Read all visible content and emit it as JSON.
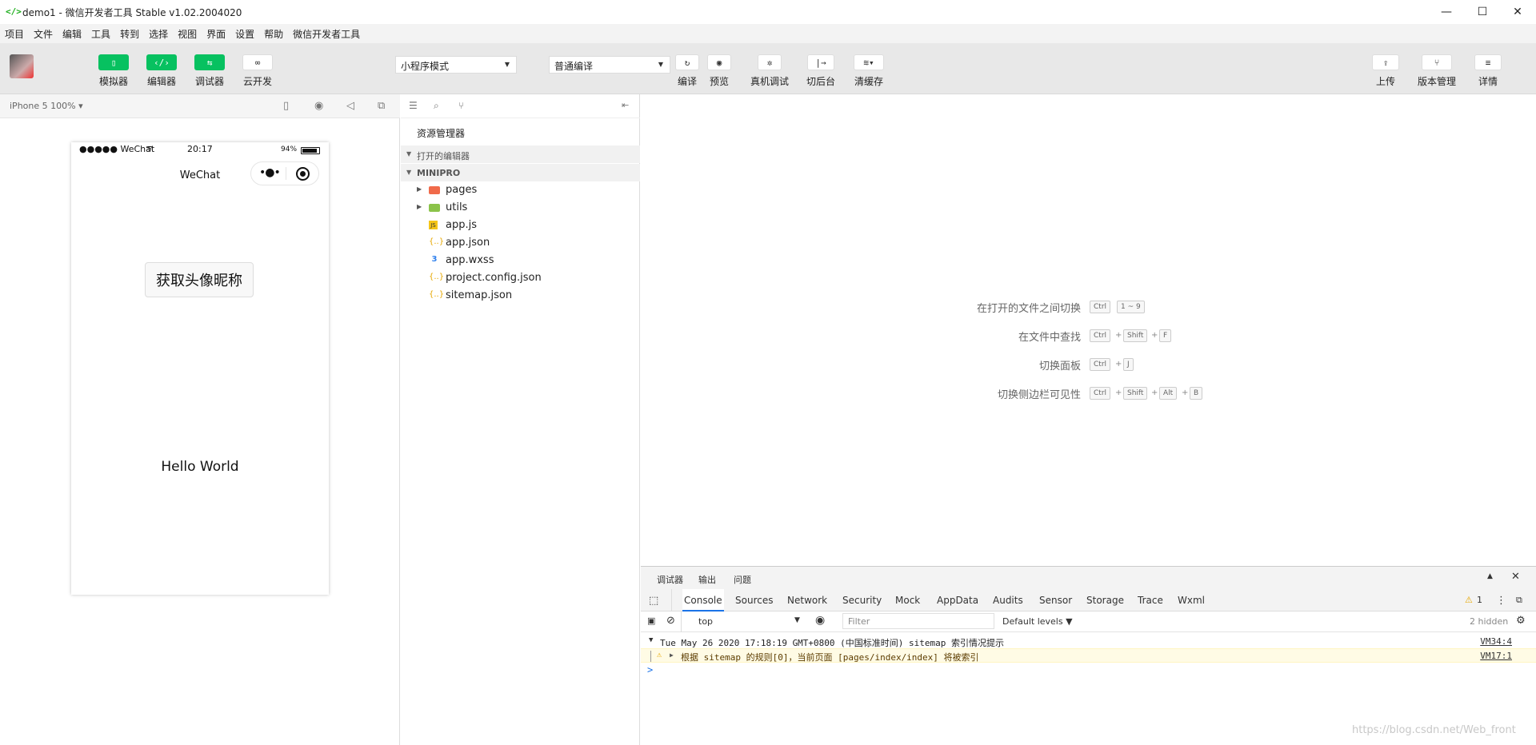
{
  "titlebar": {
    "logo": "</>",
    "title": "demo1 - 微信开发者工具 Stable v1.02.2004020",
    "minimize": "—",
    "maximize": "☐",
    "close": "✕"
  },
  "menubar": {
    "items": [
      "项目",
      "文件",
      "编辑",
      "工具",
      "转到",
      "选择",
      "视图",
      "界面",
      "设置",
      "帮助",
      "微信开发者工具"
    ]
  },
  "toolbar": {
    "simulator": "模拟器",
    "editor": "编辑器",
    "debugger": "调试器",
    "cloud": "云开发",
    "mode_select": "小程序模式",
    "compile_select": "普通编译",
    "compile": "编译",
    "preview": "预览",
    "remote_debug": "真机调试",
    "background": "切后台",
    "clear_cache": "清缓存",
    "upload": "上传",
    "version": "版本管理",
    "details": "详情"
  },
  "simulator": {
    "device": "iPhone 5 100% ▾",
    "status_left": "●●●●● WeChat",
    "time": "20:17",
    "battery": "94%",
    "nav_title": "WeChat",
    "button_label": "获取头像昵称",
    "hello_text": "Hello World"
  },
  "explorer": {
    "title": "资源管理器",
    "open_editors": "打开的编辑器",
    "project": "MINIPRO",
    "files": [
      {
        "name": "pages",
        "type": "folder"
      },
      {
        "name": "utils",
        "type": "folder"
      },
      {
        "name": "app.js",
        "type": "js"
      },
      {
        "name": "app.json",
        "type": "json"
      },
      {
        "name": "app.wxss",
        "type": "css"
      },
      {
        "name": "project.config.json",
        "type": "json"
      },
      {
        "name": "sitemap.json",
        "type": "json"
      }
    ]
  },
  "editor_hints": [
    {
      "label": "在打开的文件之间切换",
      "keys": [
        "Ctrl",
        "1 ~ 9"
      ]
    },
    {
      "label": "在文件中查找",
      "keys": [
        "Ctrl",
        "Shift",
        "F"
      ]
    },
    {
      "label": "切换面板",
      "keys": [
        "Ctrl",
        "J"
      ]
    },
    {
      "label": "切换侧边栏可见性",
      "keys": [
        "Ctrl",
        "Shift",
        "Alt",
        "B"
      ]
    }
  ],
  "devtools": {
    "top_tabs": [
      "调试器",
      "输出",
      "问题"
    ],
    "tabs": [
      "Console",
      "Sources",
      "Network",
      "Security",
      "Mock",
      "AppData",
      "Audits",
      "Sensor",
      "Storage",
      "Trace",
      "Wxml"
    ],
    "warning_count": "1",
    "context": "top",
    "filter_placeholder": "Filter",
    "levels": "Default levels ▼",
    "hidden": "2 hidden",
    "log_group": "Tue May 26 2020 17:18:19 GMT+0800 (中国标准时间) sitemap 索引情况提示",
    "log_group_link": "VM34:4",
    "log_warn": "根据 sitemap 的规则[0]，当前页面 [pages/index/index] 将被索引",
    "log_warn_link": "VM17:1",
    "prompt": ">"
  },
  "watermark": "https://blog.csdn.net/Web_front"
}
